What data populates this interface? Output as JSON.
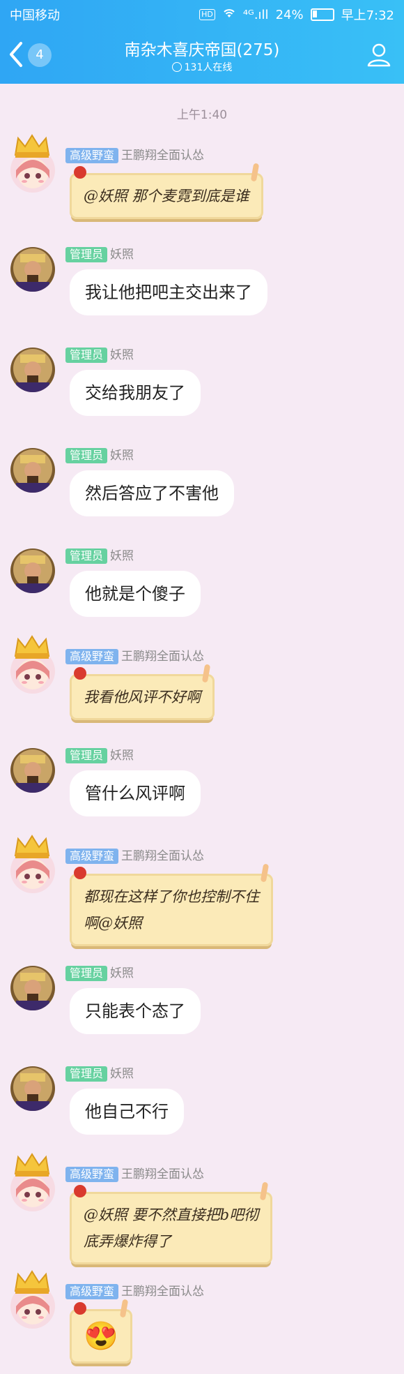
{
  "status": {
    "carrier": "中国移动",
    "hd": "HD",
    "signal": "⁴ᴳ.ıll",
    "battery": "24%",
    "battery_level": 0.24,
    "time": "早上7:32"
  },
  "header": {
    "unread": "4",
    "title": "南杂木喜庆帝国(275)",
    "online": "131人在线"
  },
  "divider_time": "上午1:40",
  "tags": {
    "admin": "管理员",
    "senior": "高级野蛮"
  },
  "names": {
    "a": "妖照",
    "b": "王鹏翔全面认怂"
  },
  "messages": [
    {
      "text": "@妖照 那个麦霓到底是谁"
    },
    {
      "text": "我让他把吧主交出来了"
    },
    {
      "text": "交给我朋友了"
    },
    {
      "text": "然后答应了不害他"
    },
    {
      "text": "他就是个傻子"
    },
    {
      "text": "我看他风评不好啊"
    },
    {
      "text": "管什么风评啊"
    },
    {
      "line1": "都现在这样了你也控制不住",
      "line2": "啊@妖照"
    },
    {
      "text": "只能表个态了"
    },
    {
      "text": "他自己不行"
    },
    {
      "line1": "@妖照 要不然直接把b吧彻",
      "line2": "底弄爆炸得了"
    },
    {
      "emoji": "😍"
    }
  ]
}
